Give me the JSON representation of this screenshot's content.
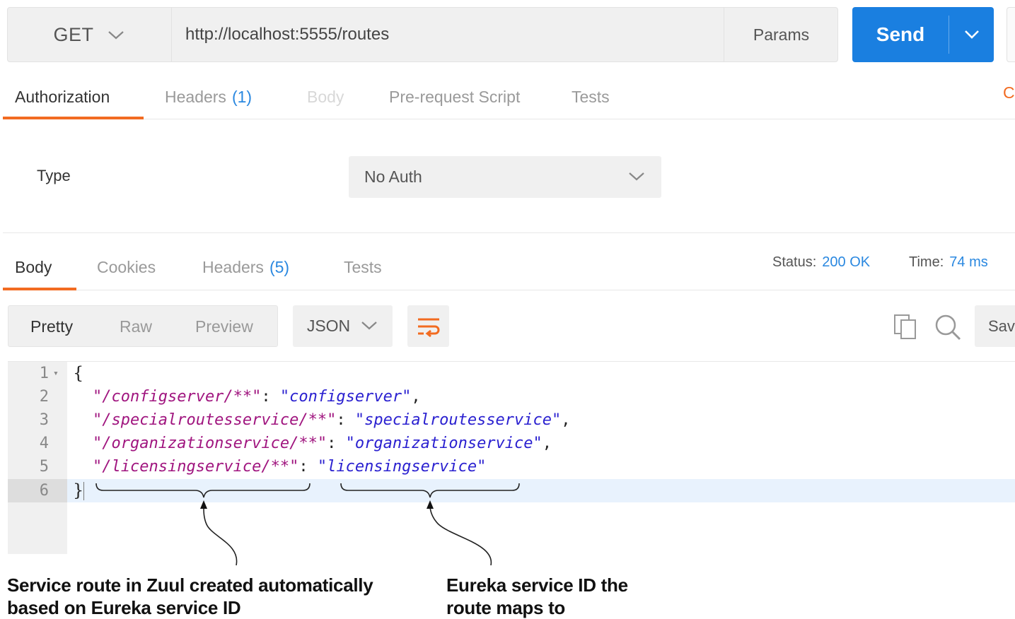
{
  "request": {
    "method": "GET",
    "url": "http://localhost:5555/routes",
    "params_label": "Params",
    "send_label": "Send"
  },
  "request_tabs": {
    "authorization": "Authorization",
    "headers": "Headers",
    "headers_count": "(1)",
    "body": "Body",
    "pre_request": "Pre-request Script",
    "tests": "Tests",
    "cookies_partial": "C"
  },
  "auth": {
    "type_label": "Type",
    "type_value": "No Auth"
  },
  "response_tabs": {
    "body": "Body",
    "cookies": "Cookies",
    "headers": "Headers",
    "headers_count": "(5)",
    "tests": "Tests"
  },
  "response_meta": {
    "status_label": "Status:",
    "status_value": "200 OK",
    "time_label": "Time:",
    "time_value": "74 ms"
  },
  "viewer": {
    "pretty": "Pretty",
    "raw": "Raw",
    "preview": "Preview",
    "format": "JSON",
    "save_partial": "Sav"
  },
  "code": {
    "line_numbers": [
      "1",
      "2",
      "3",
      "4",
      "5",
      "6"
    ],
    "open_brace": "{",
    "close_brace": "}",
    "entries": [
      {
        "key": "\"/configserver/**\"",
        "value": "\"configserver\"",
        "sep": ",",
        "colon": ": "
      },
      {
        "key": "\"/specialroutesservice/**\"",
        "value": "\"specialroutesservice\"",
        "sep": ",",
        "colon": ": "
      },
      {
        "key": "\"/organizationservice/**\"",
        "value": "\"organizationservice\"",
        "sep": ",",
        "colon": ": "
      },
      {
        "key": "\"/licensingservice/**\"",
        "value": "\"licensingservice\"",
        "sep": "",
        "colon": ": "
      }
    ]
  },
  "annotations": {
    "left_line1": "Service route in Zuul created automatically",
    "left_line2": "based on Eureka service ID",
    "right_line1": "Eureka service ID the",
    "right_line2": "route maps to"
  },
  "colors": {
    "accent_orange": "#f26b21",
    "send_blue": "#1a7fe0",
    "count_blue": "#2a88e0",
    "json_key": "#a0157f",
    "json_string": "#2a20d0"
  }
}
